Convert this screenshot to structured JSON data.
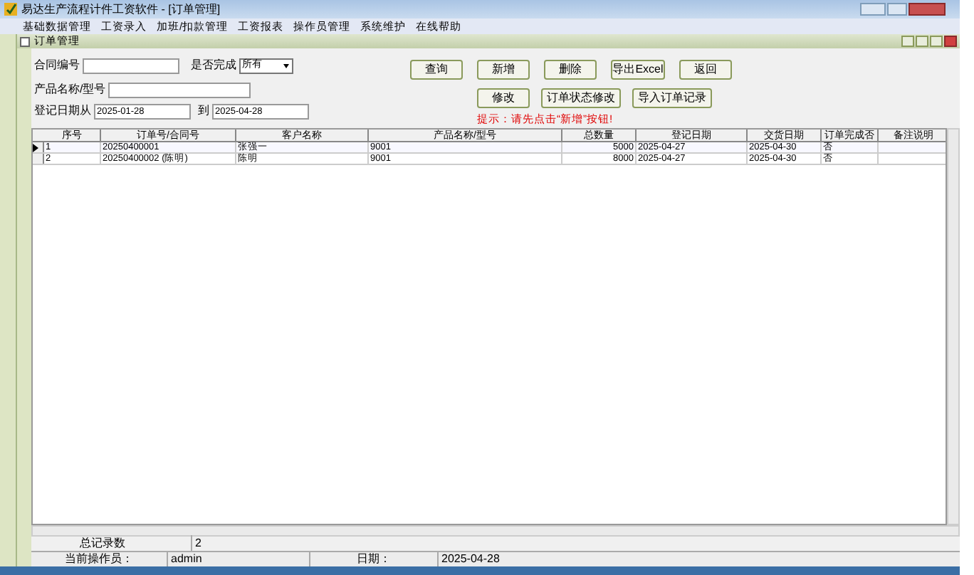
{
  "window": {
    "title": "易达生产流程计件工资软件  - [订单管理]"
  },
  "menu": [
    "基础数据管理",
    "工资录入",
    "加班/扣款管理",
    "工资报表",
    "操作员管理",
    "系统维护",
    "在线帮助"
  ],
  "child_window": {
    "title": "订单管理"
  },
  "filters": {
    "contract_label": "合同编号",
    "done_label": "是否完成",
    "done_value": "所有",
    "product_label": "产品名称/型号",
    "date_label": "登记日期从",
    "date_from": "2025-01-28",
    "to_label": "到",
    "date_to": "2025-04-28"
  },
  "buttons_row1": [
    "查询",
    "新增",
    "删除",
    "导出Excel",
    "返回"
  ],
  "buttons_row2": [
    "修改",
    "订单状态修改",
    "导入订单记录"
  ],
  "hint": "提示：请先点击“新增”按钮!",
  "table": {
    "columns": [
      "序号",
      "订单号/合同号",
      "客户名称",
      "产品名称/型号",
      "总数量",
      "登记日期",
      "交货日期",
      "订单完成否",
      "备注说明"
    ],
    "rows": [
      {
        "selected": true,
        "cells": [
          "1",
          "20250400001",
          "张强一",
          "9001",
          "5000",
          "2025-04-27",
          "2025-04-30",
          "否"
        ]
      },
      {
        "selected": false,
        "cells": [
          "2",
          "20250400002 (陈明)",
          "陈明",
          "9001",
          "8000",
          "2025-04-27",
          "2025-04-30",
          "否"
        ]
      }
    ]
  },
  "total": {
    "label": "总记录数",
    "value": "2"
  },
  "status_bar": {
    "operator_label": "当前操作员：",
    "operator": "admin",
    "date_label": "日期：",
    "date": "2025-04-28"
  }
}
